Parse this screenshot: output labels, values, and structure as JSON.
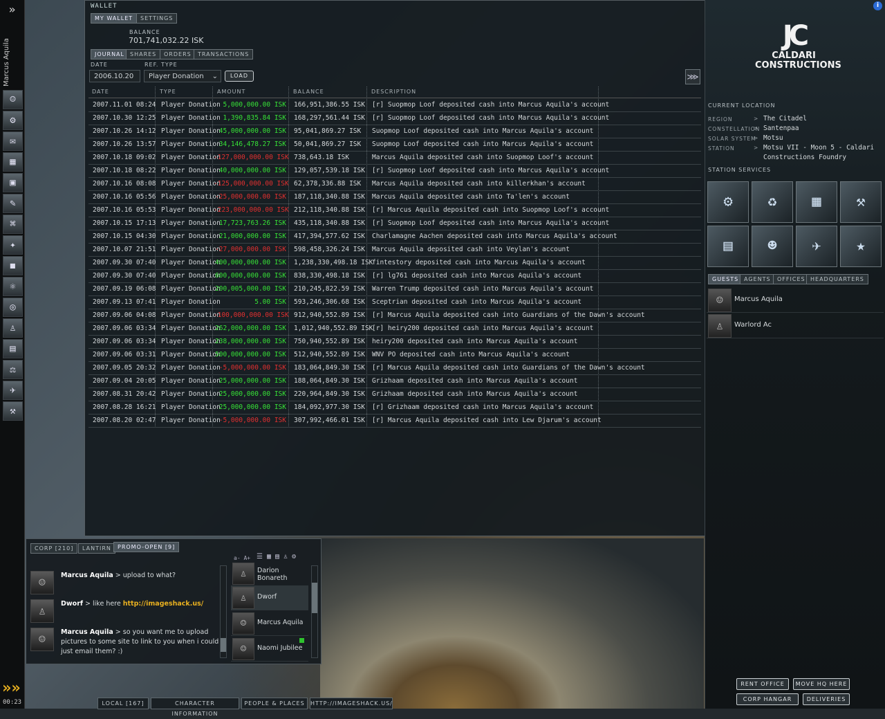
{
  "neocom": {
    "character_name": "Marcus Aquila",
    "clock": "00:23"
  },
  "wallet": {
    "title": "WALLET",
    "tabs": [
      "MY WALLET",
      "SETTINGS"
    ],
    "balance_label": "BALANCE",
    "balance_value": "701,741,032.22 ISK",
    "subtabs": [
      "JOURNAL",
      "SHARES",
      "ORDERS",
      "TRANSACTIONS"
    ],
    "date_label": "DATE",
    "date_value": "2006.10.20",
    "reftype_label": "REF. TYPE",
    "reftype_value": "Player Donation",
    "load_label": "LOAD",
    "columns": [
      "DATE",
      "TYPE",
      "AMOUNT",
      "BALANCE",
      "DESCRIPTION"
    ],
    "rows": [
      {
        "date": "2007.11.01  08:24",
        "type": "Player Donation",
        "amount": "5,000,000.00  ISK",
        "sign": "pos",
        "balance": "166,951,386.55  ISK",
        "desc": "[r] Suopmop Loof deposited cash into Marcus Aquila's account"
      },
      {
        "date": "2007.10.30  12:25",
        "type": "Player Donation",
        "amount": "1,390,835.84  ISK",
        "sign": "pos",
        "balance": "168,297,561.44  ISK",
        "desc": "[r] Suopmop Loof deposited cash into Marcus Aquila's account"
      },
      {
        "date": "2007.10.26  14:12",
        "type": "Player Donation",
        "amount": "45,000,000.00  ISK",
        "sign": "pos",
        "balance": "95,041,869.27  ISK",
        "desc": "Suopmop Loof deposited cash into Marcus Aquila's account"
      },
      {
        "date": "2007.10.26  13:57",
        "type": "Player Donation",
        "amount": "34,146,478.27  ISK",
        "sign": "pos",
        "balance": "50,041,869.27  ISK",
        "desc": "Suopmop Loof deposited cash into Marcus Aquila's account"
      },
      {
        "date": "2007.10.18  09:02",
        "type": "Player Donation",
        "amount": "-127,000,000.00  ISK",
        "sign": "neg",
        "balance": "738,643.18  ISK",
        "desc": "Marcus Aquila deposited cash into Suopmop Loof's account"
      },
      {
        "date": "2007.10.18  08:22",
        "type": "Player Donation",
        "amount": "40,000,000.00  ISK",
        "sign": "pos",
        "balance": "129,057,539.18  ISK",
        "desc": "[r] Suopmop Loof deposited cash into Marcus Aquila's account"
      },
      {
        "date": "2007.10.16  08:08",
        "type": "Player Donation",
        "amount": "-125,000,000.00  ISK",
        "sign": "neg",
        "balance": "62,378,336.88  ISK",
        "desc": "Marcus Aquila deposited cash into killerkhan's account"
      },
      {
        "date": "2007.10.16  05:56",
        "type": "Player Donation",
        "amount": "-25,000,000.00  ISK",
        "sign": "neg",
        "balance": "187,118,340.88  ISK",
        "desc": "Marcus Aquila deposited cash into Ta'len's account"
      },
      {
        "date": "2007.10.16  05:53",
        "type": "Player Donation",
        "amount": "-223,000,000.00  ISK",
        "sign": "neg",
        "balance": "212,118,340.88  ISK",
        "desc": "[r] Marcus Aquila deposited cash into Suopmop Loof's account"
      },
      {
        "date": "2007.10.15  17:13",
        "type": "Player Donation",
        "amount": "17,723,763.26  ISK",
        "sign": "pos",
        "balance": "435,118,340.88  ISK",
        "desc": "[r] Suopmop Loof deposited cash into Marcus Aquila's account"
      },
      {
        "date": "2007.10.15  04:30",
        "type": "Player Donation",
        "amount": "21,000,000.00  ISK",
        "sign": "pos",
        "balance": "417,394,577.62  ISK",
        "desc": "Charlamagne Aachen deposited cash into Marcus Aquila's account"
      },
      {
        "date": "2007.10.07  21:51",
        "type": "Player Donation",
        "amount": "-27,000,000.00  ISK",
        "sign": "neg",
        "balance": "598,458,326.24  ISK",
        "desc": "Marcus Aquila deposited cash into Veylan's account"
      },
      {
        "date": "2007.09.30  07:40",
        "type": "Player Donation",
        "amount": "400,000,000.00  ISK",
        "sign": "pos",
        "balance": "1,238,330,498.18  ISK",
        "desc": "fintestory deposited cash into Marcus Aquila's account"
      },
      {
        "date": "2007.09.30  07:40",
        "type": "Player Donation",
        "amount": "600,000,000.00  ISK",
        "sign": "pos",
        "balance": "838,330,498.18  ISK",
        "desc": "[r] lg761 deposited cash into Marcus Aquila's account"
      },
      {
        "date": "2007.09.19  06:08",
        "type": "Player Donation",
        "amount": "200,005,000.00  ISK",
        "sign": "pos",
        "balance": "210,245,822.59  ISK",
        "desc": "Warren Trump deposited cash into Marcus Aquila's account"
      },
      {
        "date": "2007.09.13  07:41",
        "type": "Player Donation",
        "amount": "5.00  ISK",
        "sign": "pos",
        "balance": "593,246,306.68  ISK",
        "desc": "Sceptrian deposited cash into Marcus Aquila's account"
      },
      {
        "date": "2007.09.06  04:08",
        "type": "Player Donation",
        "amount": "-100,000,000.00  ISK",
        "sign": "neg",
        "balance": "912,940,552.89  ISK",
        "desc": "[r] Marcus Aquila deposited cash into Guardians of the Dawn's account"
      },
      {
        "date": "2007.09.06  03:34",
        "type": "Player Donation",
        "amount": "262,000,000.00  ISK",
        "sign": "pos",
        "balance": "1,012,940,552.89  ISK",
        "desc": "[r] heiry200 deposited cash into Marcus Aquila's account"
      },
      {
        "date": "2007.09.06  03:34",
        "type": "Player Donation",
        "amount": "238,000,000.00  ISK",
        "sign": "pos",
        "balance": "750,940,552.89  ISK",
        "desc": "heiry200 deposited cash into Marcus Aquila's account"
      },
      {
        "date": "2007.09.06  03:31",
        "type": "Player Donation",
        "amount": "500,000,000.00  ISK",
        "sign": "pos",
        "balance": "512,940,552.89  ISK",
        "desc": "WNV PO deposited cash into Marcus Aquila's account"
      },
      {
        "date": "2007.09.05  20:32",
        "type": "Player Donation",
        "amount": "-5,000,000.00  ISK",
        "sign": "neg",
        "balance": "183,064,849.30  ISK",
        "desc": "[r] Marcus Aquila deposited cash into Guardians of the Dawn's account"
      },
      {
        "date": "2007.09.04  20:05",
        "type": "Player Donation",
        "amount": "25,000,000.00  ISK",
        "sign": "pos",
        "balance": "188,064,849.30  ISK",
        "desc": "Grizhaam deposited cash into Marcus Aquila's account"
      },
      {
        "date": "2007.08.31  20:42",
        "type": "Player Donation",
        "amount": "25,000,000.00  ISK",
        "sign": "pos",
        "balance": "220,964,849.30  ISK",
        "desc": "Grizhaam deposited cash into Marcus Aquila's account"
      },
      {
        "date": "2007.08.28  16:21",
        "type": "Player Donation",
        "amount": "25,000,000.00  ISK",
        "sign": "pos",
        "balance": "184,092,977.30  ISK",
        "desc": "[r] Grizhaam deposited cash into Marcus Aquila's account"
      },
      {
        "date": "2007.08.20  02:47",
        "type": "Player Donation",
        "amount": "-5,000,000.00  ISK",
        "sign": "neg",
        "balance": "307,992,466.01  ISK",
        "desc": "[r] Marcus Aquila deposited cash into Lew Djarum's account"
      }
    ]
  },
  "station": {
    "logo_line1": "CALDARI",
    "logo_line2": "CONSTRUCTIONS",
    "location_title": "CURRENT LOCATION",
    "location": [
      {
        "label": "REGION",
        "value": "The Citadel"
      },
      {
        "label": "CONSTELLATION",
        "value": "Santenpaa"
      },
      {
        "label": "SOLAR SYSTEM",
        "value": "Motsu"
      },
      {
        "label": "STATION",
        "value": "Motsu VII - Moon 5 - Caldari"
      }
    ],
    "station_line2": "Constructions Foundry",
    "services_title": "STATION SERVICES",
    "tabs": [
      "GUESTS",
      "AGENTS",
      "OFFICES",
      "HEADQUARTERS"
    ],
    "guests": [
      "Marcus Aquila",
      "Warlord Ac"
    ],
    "buttons": [
      "RENT OFFICE",
      "MOVE HQ HERE",
      "CORP HANGAR",
      "DELIVERIES"
    ]
  },
  "chat": {
    "tabs": [
      "CORP [210]",
      "LANTIRN",
      "PROMO-OPEN [9]"
    ],
    "font_controls": "a-  A+",
    "messages": [
      {
        "sender": "Marcus Aquila",
        "text": " > upload to what?"
      },
      {
        "sender": "Dworf",
        "text": " > like here ",
        "link": "http://imageshack.us/"
      },
      {
        "sender": "Marcus Aquila",
        "text": " > so you want me to upload pictures to some site to link to you when i could just email them? :)"
      }
    ],
    "members": [
      "Darion Bonareth",
      "Dworf",
      "Marcus Aquila",
      "Naomi Jubilee"
    ]
  },
  "bottom_bar": [
    "LOCAL [167]",
    "CHARACTER INFORMATION",
    "PEOPLE & PLACES",
    "HTTP://IMAGESHACK.US/"
  ]
}
